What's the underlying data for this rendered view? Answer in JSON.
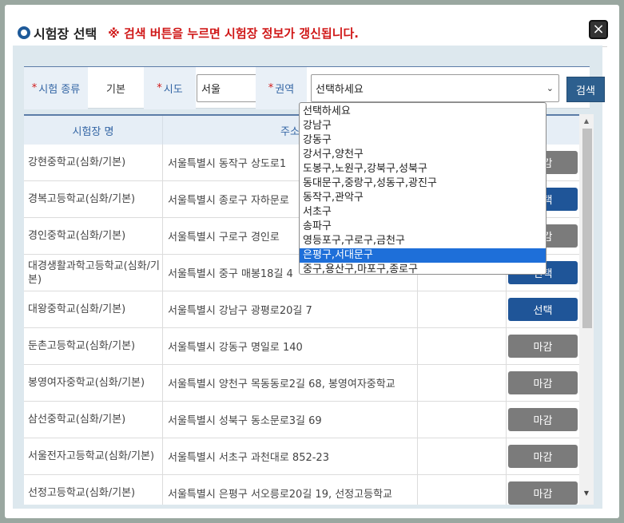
{
  "dialog": {
    "title": "시험장 선택",
    "notice": "※ 검색 버튼을 누르면 시험장 정보가 갱신됩니다.",
    "close_icon": "×"
  },
  "filters": {
    "required_mark": "*",
    "exam_type_label": "시험 종류",
    "exam_type_value": "기본",
    "sido_label": "시도",
    "sido_value": "서울",
    "region_label": "권역",
    "region_value": "선택하세요",
    "search_label": "검색",
    "chevron": "⌄"
  },
  "table": {
    "headers": [
      "시험장 명",
      "주소",
      "",
      ""
    ],
    "rows": [
      {
        "name": "강현중학교(심화/기본)",
        "address": "서울특별시 동작구 상도로1",
        "action": "마감",
        "status": "closed"
      },
      {
        "name": "경복고등학교(심화/기본)",
        "address": "서울특별시 종로구 자하문로",
        "action": "선택",
        "status": "open"
      },
      {
        "name": "경인중학교(심화/기본)",
        "address": "서울특별시 구로구 경인로",
        "action": "마감",
        "status": "closed"
      },
      {
        "name": "대경생활과학고등학교(심화/기본)",
        "address": "서울특별시 중구 매봉18길 4",
        "action": "선택",
        "status": "open"
      },
      {
        "name": "대왕중학교(심화/기본)",
        "address": "서울특별시 강남구 광평로20길 7",
        "action": "선택",
        "status": "open"
      },
      {
        "name": "둔촌고등학교(심화/기본)",
        "address": "서울특별시 강동구 명일로 140",
        "action": "마감",
        "status": "closed"
      },
      {
        "name": "봉영여자중학교(심화/기본)",
        "address": "서울특별시 양천구 목동동로2길 68, 봉영여자중학교",
        "action": "마감",
        "status": "closed"
      },
      {
        "name": "삼선중학교(심화/기본)",
        "address": "서울특별시 성북구 동소문로3길 69",
        "action": "마감",
        "status": "closed"
      },
      {
        "name": "서울전자고등학교(심화/기본)",
        "address": "서울특별시 서초구 과천대로 852-23",
        "action": "마감",
        "status": "closed"
      },
      {
        "name": "선정고등학교(심화/기본)",
        "address": "서울특별시 은평구 서오릉로20길 19, 선정고등학교",
        "action": "마감",
        "status": "closed"
      }
    ]
  },
  "region_dropdown": {
    "options": [
      "선택하세요",
      "강남구",
      "강동구",
      "강서구,양천구",
      "도봉구,노원구,강북구,성북구",
      "동대문구,중랑구,성동구,광진구",
      "동작구,관악구",
      "서초구",
      "송파구",
      "영등포구,구로구,금천구",
      "은평구,서대문구",
      "중구,용산구,마포구,종로구"
    ],
    "highlighted_index": 10
  },
  "scroll": {
    "up": "▲",
    "down": "▼"
  },
  "colors": {
    "accent": "#1f5598",
    "closed": "#7b7b7b",
    "notice": "#d01818",
    "highlight": "#1e6fd9"
  }
}
